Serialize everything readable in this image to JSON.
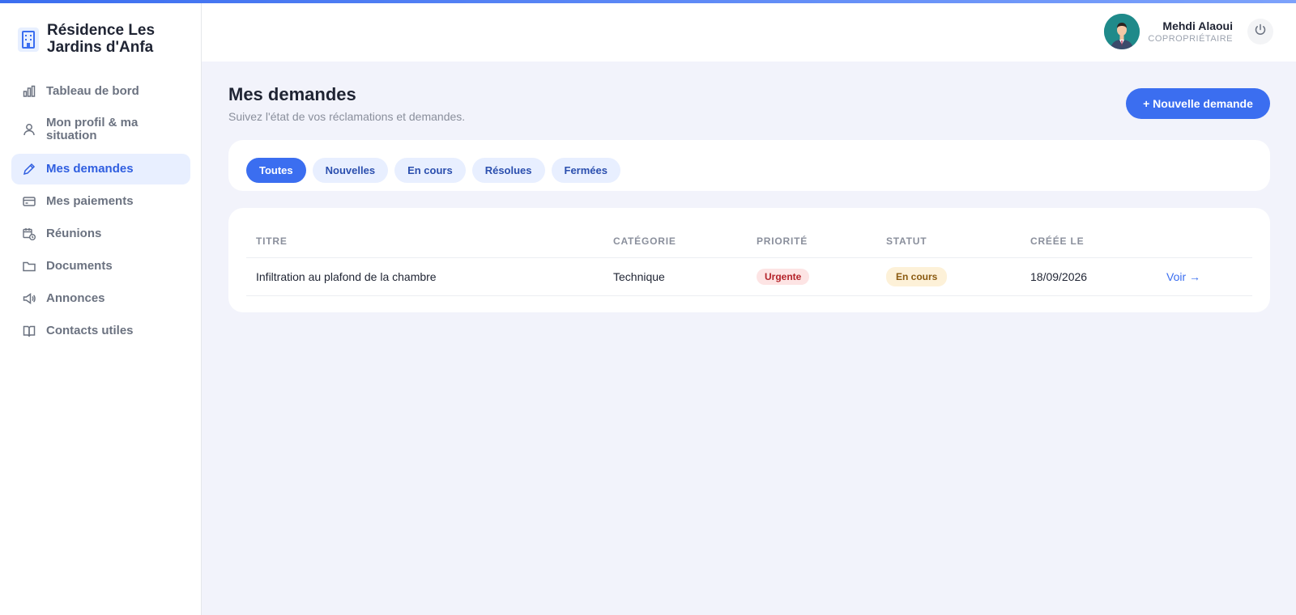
{
  "brand": {
    "title": "Résidence Les Jardins d'Anfa",
    "icon": "building-icon",
    "accent": "#3b6ef0"
  },
  "sidebar": {
    "items": [
      {
        "label": "Tableau de bord",
        "icon": "bar-chart-icon"
      },
      {
        "label": "Mon profil & ma situation",
        "icon": "user-icon"
      },
      {
        "label": "Mes demandes",
        "icon": "pencil-icon",
        "active": true
      },
      {
        "label": "Mes paiements",
        "icon": "credit-card-icon"
      },
      {
        "label": "Réunions",
        "icon": "calendar-clock-icon"
      },
      {
        "label": "Documents",
        "icon": "folder-icon"
      },
      {
        "label": "Annonces",
        "icon": "megaphone-icon"
      },
      {
        "label": "Contacts utiles",
        "icon": "book-icon"
      }
    ]
  },
  "header": {
    "user_name": "Mehdi Alaoui",
    "user_role": "COPROPRIÉTAIRE",
    "logout_icon": "power-icon"
  },
  "main": {
    "title": "Mes demandes",
    "subtitle": "Suivez l'état de vos réclamations et demandes.",
    "new_button": "+ Nouvelle demande",
    "filters": [
      "Toutes",
      "Nouvelles",
      "En cours",
      "Résolues",
      "Fermées"
    ],
    "active_filter": "Toutes",
    "table": {
      "headers": [
        "TITRE",
        "CATÉGORIE",
        "PRIORITÉ",
        "STATUT",
        "CRÉÉE LE"
      ],
      "rows": [
        {
          "title": "Infiltration au plafond de la chambre",
          "category": "Technique",
          "priority": "Urgente",
          "status": "En cours",
          "created": "18/09/2026",
          "action": "Voir →"
        }
      ]
    }
  }
}
